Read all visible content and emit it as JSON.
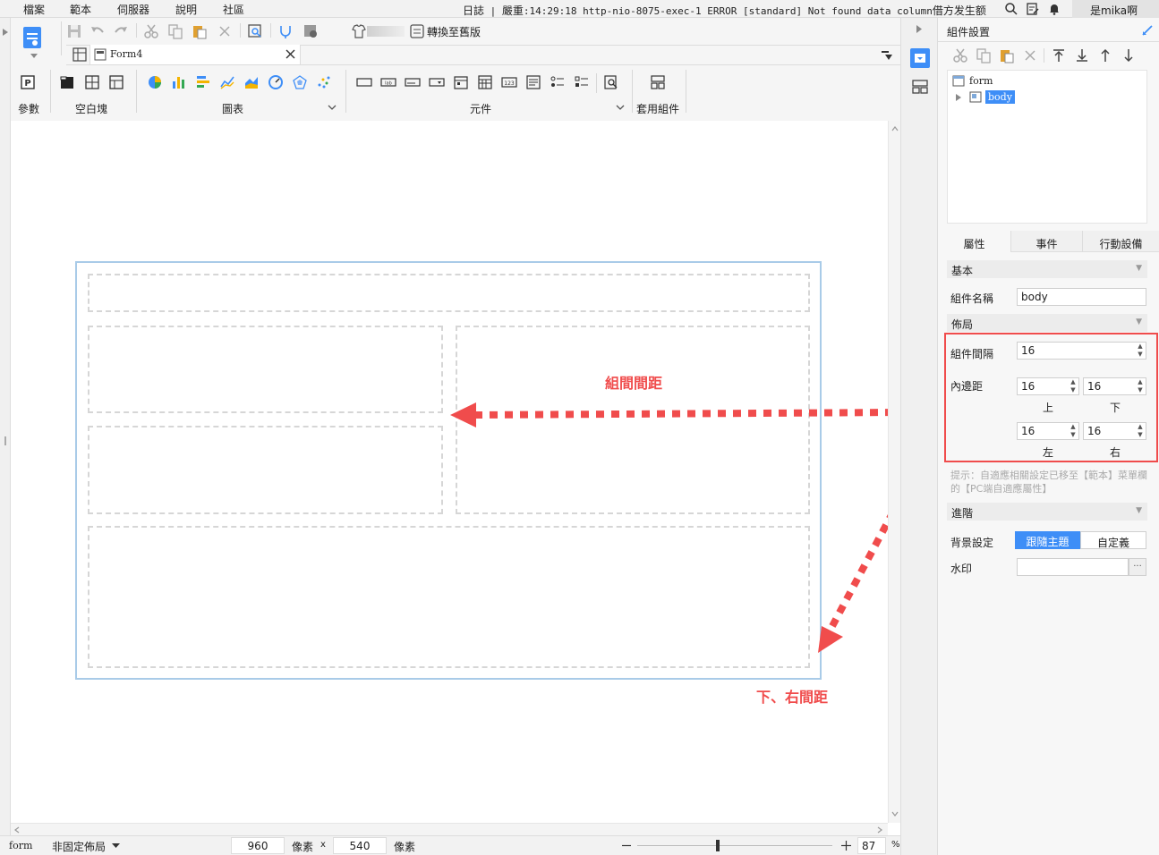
{
  "menu": {
    "items": [
      "檔案",
      "範本",
      "伺服器",
      "說明",
      "社區"
    ]
  },
  "log": {
    "prefix": "日誌",
    "level": "嚴重",
    "time": "14:29:18",
    "thread": "http-nio-8075-exec-1",
    "error": "ERROR [standard] Not found data column",
    "suffix": "借方发生额"
  },
  "user": {
    "name": "是mika啊"
  },
  "toolbar": {
    "convert_label": "轉換至舊版",
    "tab_name": "Form4",
    "groups": [
      "參數",
      "空白塊",
      "圖表",
      "元件",
      "套用組件"
    ],
    "widget_texts": [
      "lab",
      "123"
    ]
  },
  "canvas": {
    "annotations": {
      "gap_label": "組間間距",
      "padding_label": "下、右間距"
    }
  },
  "status": {
    "mode": "form",
    "layout": "非固定佈局",
    "width": "960",
    "unit1": "像素",
    "times": "x",
    "height": "540",
    "unit2": "像素",
    "zoom": "87",
    "percent": "%"
  },
  "panel": {
    "title": "組件設置",
    "tree": {
      "root": "form",
      "child": "body"
    },
    "tabs": [
      "屬性",
      "事件",
      "行動設備"
    ],
    "basic": {
      "section": "基本",
      "name_label": "組件名稱",
      "name_value": "body"
    },
    "layout": {
      "section": "佈局",
      "gap_label": "組件間隔",
      "gap_value": "16",
      "padding_label": "內邊距",
      "top": "16",
      "bottom": "16",
      "left": "16",
      "right": "16",
      "top_lbl": "上",
      "bottom_lbl": "下",
      "left_lbl": "左",
      "right_lbl": "右"
    },
    "hint": "提示：自適應相關設定已移至【範本】菜單欄的【PC端自適應屬性】",
    "advanced": {
      "section": "進階",
      "bg_label": "背景設定",
      "opt_theme": "跟隨主題",
      "opt_custom": "自定義",
      "watermark_label": "水印",
      "watermark_btn": "···"
    }
  },
  "colors": {
    "accent": "#3e8ef7",
    "annotation": "#f04c4c",
    "frame": "#a9cbe8"
  }
}
